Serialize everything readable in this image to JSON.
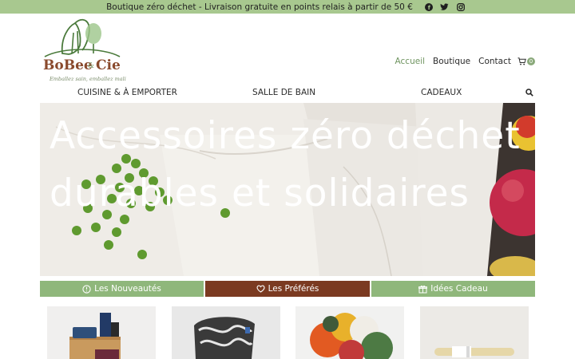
{
  "topbar": {
    "message": "Boutique zéro déchet - Livraison gratuite en points relais à partir de 50 €",
    "social": [
      "facebook-icon",
      "twitter-icon",
      "instagram-icon"
    ]
  },
  "logo": {
    "name": "BoBee & Cie",
    "tagline": "Emballez sain, emballez malin !"
  },
  "nav": {
    "items": [
      {
        "label": "Accueil",
        "active": true
      },
      {
        "label": "Boutique",
        "active": false
      },
      {
        "label": "Contact",
        "active": false
      }
    ],
    "cart_count": "0"
  },
  "categories": [
    "CUISINE & À EMPORTER",
    "SALLE DE BAIN",
    "CADEAUX"
  ],
  "hero": {
    "title_line1": "Accessoires zéro déchet",
    "title_line2": "durables et solidaires"
  },
  "tabs": [
    {
      "label": "Les Nouveautés",
      "icon": "clock-icon",
      "color": "#8fb77b"
    },
    {
      "label": "Les Préférés",
      "icon": "heart-icon",
      "color": "#7b3a21"
    },
    {
      "label": "Idées Cadeau",
      "icon": "gift-icon",
      "color": "#8fb77b"
    }
  ],
  "colors": {
    "topbar": "#a8c88f",
    "accent_green": "#8fb77b",
    "accent_brown": "#7b3a21"
  }
}
